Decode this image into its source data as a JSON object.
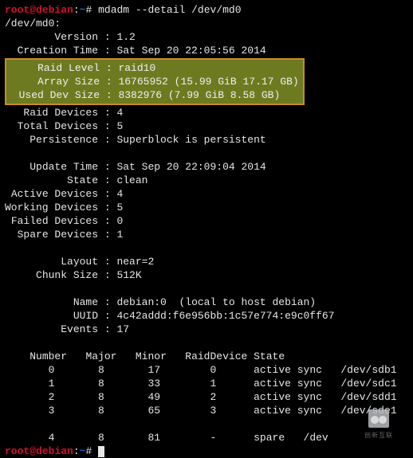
{
  "prompt1": {
    "user": "root",
    "host": "debian",
    "path": "~",
    "symbol": "#",
    "command": "mdadm --detail /dev/md0"
  },
  "device_line": "/dev/md0:",
  "fields": {
    "version": {
      "label": "Version",
      "value": "1.2"
    },
    "creation": {
      "label": "Creation Time",
      "value": "Sat Sep 20 22:05:56 2014"
    },
    "raid_level": {
      "label": "Raid Level",
      "value": "raid10"
    },
    "array_size": {
      "label": "Array Size",
      "value": "16765952 (15.99 GiB 17.17 GB)"
    },
    "used_dev": {
      "label": "Used Dev Size",
      "value": "8382976 (7.99 GiB 8.58 GB)"
    },
    "raid_dev": {
      "label": "Raid Devices",
      "value": "4"
    },
    "total_dev": {
      "label": "Total Devices",
      "value": "5"
    },
    "persist": {
      "label": "Persistence",
      "value": "Superblock is persistent"
    },
    "update": {
      "label": "Update Time",
      "value": "Sat Sep 20 22:09:04 2014"
    },
    "state": {
      "label": "State",
      "value": "clean"
    },
    "active": {
      "label": "Active Devices",
      "value": "4"
    },
    "working": {
      "label": "Working Devices",
      "value": "5"
    },
    "failed": {
      "label": "Failed Devices",
      "value": "0"
    },
    "spare": {
      "label": "Spare Devices",
      "value": "1"
    },
    "layout": {
      "label": "Layout",
      "value": "near=2"
    },
    "chunk": {
      "label": "Chunk Size",
      "value": "512K"
    },
    "name": {
      "label": "Name",
      "value": "debian:0  (local to host debian)"
    },
    "uuid": {
      "label": "UUID",
      "value": "4c42addd:f6e956bb:1c57e774:e9c0ff67"
    },
    "events": {
      "label": "Events",
      "value": "17"
    }
  },
  "table": {
    "headers": {
      "number": "Number",
      "major": "Major",
      "minor": "Minor",
      "raiddev": "RaidDevice",
      "state": "State"
    },
    "rows": [
      {
        "number": "0",
        "major": "8",
        "minor": "17",
        "rd": "0",
        "state": "active sync",
        "dev": "/dev/sdb1"
      },
      {
        "number": "1",
        "major": "8",
        "minor": "33",
        "rd": "1",
        "state": "active sync",
        "dev": "/dev/sdc1"
      },
      {
        "number": "2",
        "major": "8",
        "minor": "49",
        "rd": "2",
        "state": "active sync",
        "dev": "/dev/sdd1"
      },
      {
        "number": "3",
        "major": "8",
        "minor": "65",
        "rd": "3",
        "state": "active sync",
        "dev": "/dev/sde1"
      }
    ],
    "spare_row": {
      "number": "4",
      "major": "8",
      "minor": "81",
      "rd": "-",
      "state": "spare",
      "dev": "/dev"
    }
  },
  "prompt2": {
    "user": "root",
    "host": "debian",
    "path": "~",
    "symbol": "#"
  },
  "watermark": "创新互联"
}
